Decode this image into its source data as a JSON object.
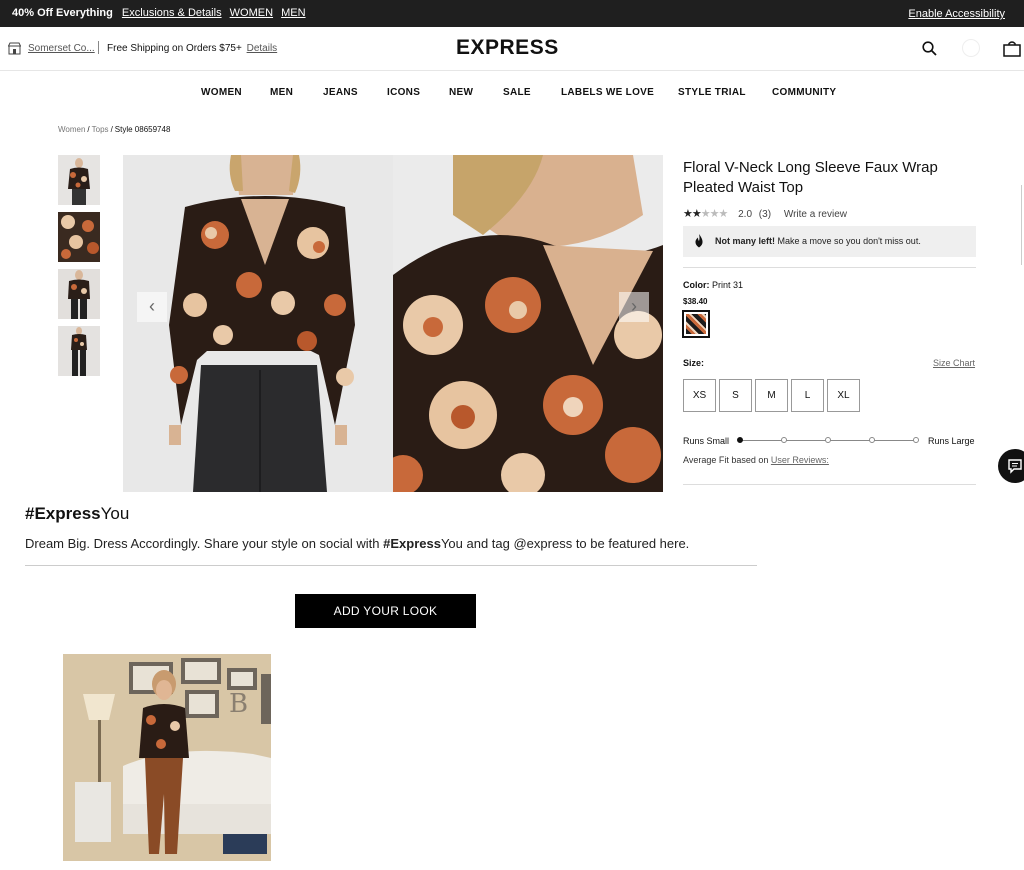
{
  "promo": {
    "headline": "40% Off Everything",
    "links": [
      "Exclusions & Details",
      "WOMEN",
      "MEN"
    ],
    "accessibility": "Enable Accessibility"
  },
  "header": {
    "store": "Somerset Co...",
    "shipping": "Free Shipping on Orders $75+",
    "shipping_link": "Details",
    "logo": "EXPRESS"
  },
  "nav": [
    "WOMEN",
    "MEN",
    "JEANS",
    "ICONS",
    "NEW",
    "SALE",
    "LABELS WE LOVE",
    "STYLE TRIAL",
    "COMMUNITY"
  ],
  "breadcrumb": {
    "items": [
      "Women",
      "Tops"
    ],
    "current": "Style 08659748"
  },
  "product": {
    "title": "Floral V-Neck Long Sleeve Faux Wrap Pleated Waist Top",
    "rating": 2.0,
    "rating_text": "2.0",
    "review_count": "(3)",
    "write_review": "Write a review",
    "notice_bold": "Not many left!",
    "notice_text": "Make a move so you don't miss out.",
    "color_label": "Color:",
    "color_value": "Print 31",
    "price": "$38.40",
    "size_label": "Size:",
    "size_chart": "Size Chart",
    "sizes": [
      "XS",
      "S",
      "M",
      "L",
      "XL"
    ],
    "fit_small": "Runs Small",
    "fit_large": "Runs Large",
    "fit_position": 0,
    "fit_steps": 5,
    "avg_fit_text": "Average Fit based on",
    "avg_fit_link": "User Reviews:"
  },
  "express_you": {
    "title_bold": "#Express",
    "title_rest": "You",
    "text_1": "Dream Big. Dress Accordingly. Share your style on social with ",
    "text_bold": "#Express",
    "text_2": "You and tag @express to be featured here.",
    "button": "ADD YOUR LOOK"
  },
  "colors": {
    "promo_bg": "#1f1f1f",
    "print_black": "#1c1c1c",
    "print_orange": "#c9693a",
    "print_cream": "#efd4bb"
  },
  "icons": [
    "store-icon",
    "search-icon",
    "account-icon",
    "bag-icon",
    "flame-icon",
    "chat-icon",
    "chevron-left-icon",
    "chevron-right-icon"
  ]
}
